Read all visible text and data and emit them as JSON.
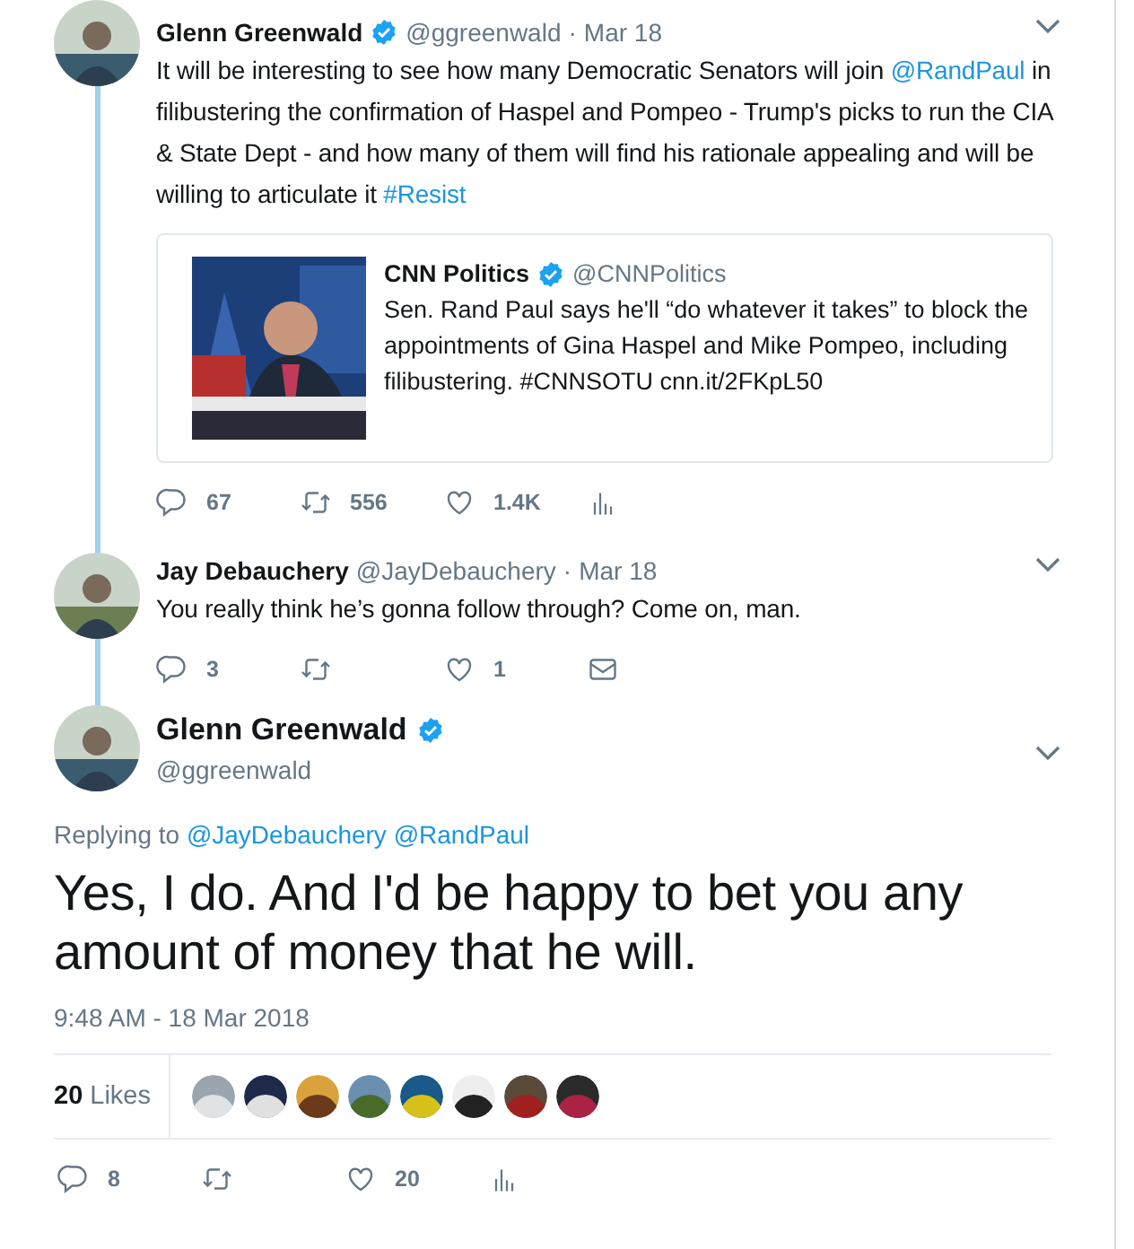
{
  "thread": [
    {
      "author": {
        "name": "Glenn Greenwald",
        "verified": true,
        "handle": "@ggreenwald",
        "separator": "·",
        "date": "Mar 18"
      },
      "text": [
        {
          "kind": "plain",
          "text": "It will be interesting to see how many Democratic Senators will join "
        },
        {
          "kind": "link",
          "text": "@RandPaul"
        },
        {
          "kind": "plain",
          "text": " in filibustering the confirmation of Haspel and Pompeo - Trump's picks to run the CIA & State Dept - and how many of them will find his rationale appealing and will be willing to articulate it "
        },
        {
          "kind": "link",
          "text": "#Resist"
        }
      ],
      "quote": {
        "name": "CNN Politics",
        "verified": true,
        "handle": "@CNNPolitics",
        "text": "Sen. Rand Paul says he'll “do whatever it takes” to block the appointments of Gina Haspel and Mike Pompeo, including filibustering. #CNNSOTU cnn.it/2FKpL50"
      },
      "actions": [
        {
          "kind": "reply",
          "count": "67"
        },
        {
          "kind": "retweet",
          "count": "556"
        },
        {
          "kind": "like",
          "count": "1.4K"
        },
        {
          "kind": "analytics"
        }
      ]
    },
    {
      "author": {
        "name": "Jay Debauchery",
        "verified": false,
        "handle": "@JayDebauchery",
        "separator": "·",
        "date": "Mar 18"
      },
      "text": [
        {
          "kind": "plain",
          "text": "You really think he’s gonna follow through? Come on, man."
        }
      ],
      "actions": [
        {
          "kind": "reply",
          "count": "3"
        },
        {
          "kind": "retweet"
        },
        {
          "kind": "like",
          "count": "1"
        },
        {
          "kind": "message"
        }
      ]
    }
  ],
  "focused": {
    "name": "Glenn Greenwald",
    "verified": true,
    "handle": "@ggreenwald",
    "replying_label": "Replying to",
    "replying_to": [
      "@JayDebauchery",
      "@RandPaul"
    ],
    "text": "Yes, I do. And I'd be happy to bet you any amount of money that he will.",
    "timestamp": "9:48 AM - 18 Mar 2018",
    "likes_count": "20",
    "likes_label": "Likes",
    "actions": [
      {
        "kind": "reply",
        "count": "8"
      },
      {
        "kind": "retweet"
      },
      {
        "kind": "like",
        "count": "20"
      },
      {
        "kind": "analytics"
      }
    ]
  }
}
